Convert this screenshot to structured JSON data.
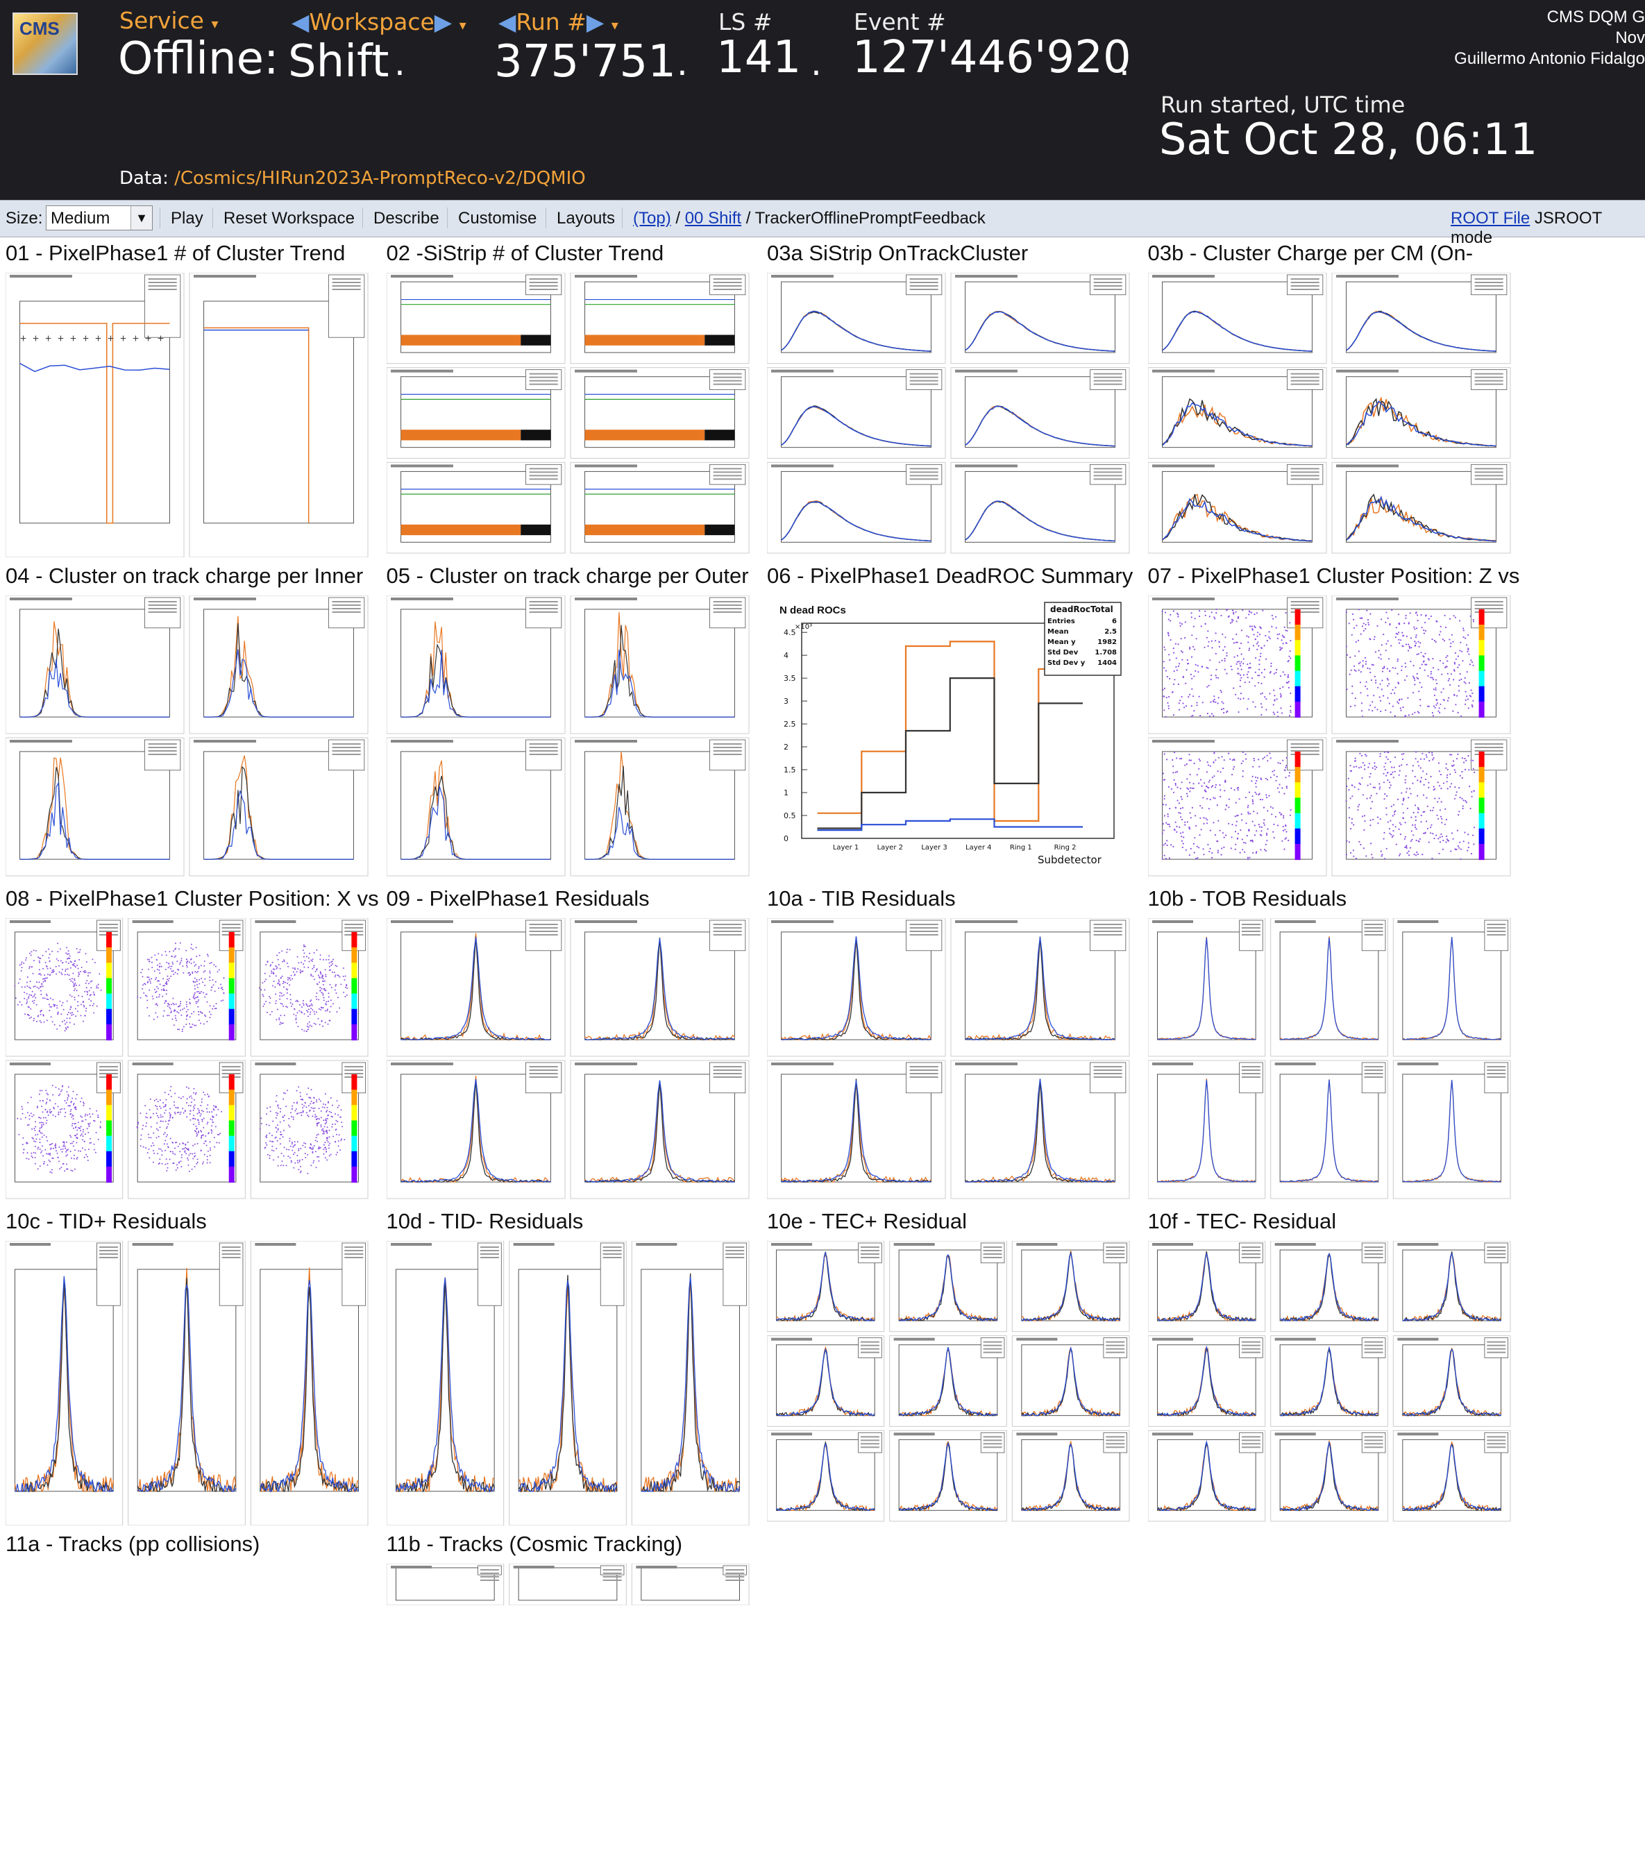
{
  "header": {
    "logo_text": "CMS",
    "service_label": "Service",
    "service_value": "Offline:",
    "workspace_label": "Workspace",
    "workspace_value": "Shift",
    "run_label": "Run #",
    "run_value": "375'751",
    "ls_label": "LS #",
    "ls_value": "141",
    "event_label": "Event #",
    "event_value": "127'446'920",
    "separator": ".",
    "user_line1": "CMS DQM G",
    "user_line2": "Nov",
    "user_line3": "Guillermo Antonio Fidalgo",
    "run_started_label": "Run started, UTC time",
    "run_started_value": "Sat Oct 28, 06:11",
    "data_label": "Data:",
    "data_path": "/Cosmics/HIRun2023A-PromptReco-v2/DQMIO"
  },
  "toolbar": {
    "size_label": "Size:",
    "size_value": "Medium",
    "play": "Play",
    "reset_workspace": "Reset Workspace",
    "describe": "Describe",
    "customise": "Customise",
    "layouts": "Layouts",
    "crumb_top": "(Top)",
    "crumb_slash1": "/",
    "crumb_shift": "00 Shift",
    "crumb_current": "/ TrackerOfflinePromptFeedback",
    "root_file": "ROOT File",
    "jsroot": "JSROOT mode"
  },
  "plots": [
    {
      "title": "01 - PixelPhase1 # of Cluster Trend",
      "kind": "trend2"
    },
    {
      "title": "02 -SiStrip # of Cluster Trend",
      "kind": "strip6"
    },
    {
      "title": "03a SiStrip OnTrackCluster",
      "kind": "landau6"
    },
    {
      "title": "03b - Cluster Charge per CM (On-",
      "kind": "landau6noisy"
    },
    {
      "title": "04 - Cluster on track charge per Inner",
      "kind": "spiky4"
    },
    {
      "title": "05 - Cluster on track charge per Outer",
      "kind": "spiky4"
    },
    {
      "title": "06 - PixelPhase1 DeadROC Summary",
      "kind": "deadroc"
    },
    {
      "title": "07 - PixelPhase1 Cluster Position: Z vs",
      "kind": "scatter4"
    },
    {
      "title": "08 - PixelPhase1 Cluster Position: X vs",
      "kind": "ring6"
    },
    {
      "title": "09 - PixelPhase1 Residuals",
      "kind": "peak4"
    },
    {
      "title": "10a - TIB Residuals",
      "kind": "peak4"
    },
    {
      "title": "10b - TOB Residuals",
      "kind": "peak6"
    },
    {
      "title": "10c - TID+ Residuals",
      "kind": "peak3tall"
    },
    {
      "title": "10d - TID- Residuals",
      "kind": "peak3tall"
    },
    {
      "title": "10e - TEC+ Residual",
      "kind": "peak9"
    },
    {
      "title": "10f - TEC- Residual",
      "kind": "peak9"
    },
    {
      "title": "11a - Tracks (pp collisions)",
      "kind": "none"
    },
    {
      "title": "11b - Tracks (Cosmic Tracking)",
      "kind": "partial"
    }
  ],
  "deadroc": {
    "title": "N dead ROCs",
    "stats_title": "deadRocTotal",
    "stats": [
      [
        "Entries",
        "6"
      ],
      [
        "Mean",
        "2.5"
      ],
      [
        "Mean y",
        "1982"
      ],
      [
        "Std Dev",
        "1.708"
      ],
      [
        "Std Dev y",
        "1404"
      ]
    ],
    "xlabel": "Subdetector",
    "categories": [
      "Layer 1",
      "Layer 2",
      "Layer 3",
      "Layer 4",
      "Ring 1",
      "Ring 2"
    ],
    "yticks": [
      "4.5",
      "4",
      "3.5",
      "3",
      "2.5",
      "2",
      "1.5",
      "1",
      "0.5",
      "0"
    ],
    "ymax_label": "×10³",
    "orange": [
      550,
      1900,
      4200,
      4300,
      380,
      3700
    ],
    "black": [
      220,
      1000,
      2350,
      3500,
      1200,
      2950
    ],
    "blue": [
      180,
      300,
      380,
      420,
      250,
      250
    ]
  },
  "colors": {
    "orange": "#e87722",
    "black": "#333333",
    "blue": "#2a4fd6",
    "header_bg": "#1e1e22",
    "accent": "#f3a33a"
  }
}
